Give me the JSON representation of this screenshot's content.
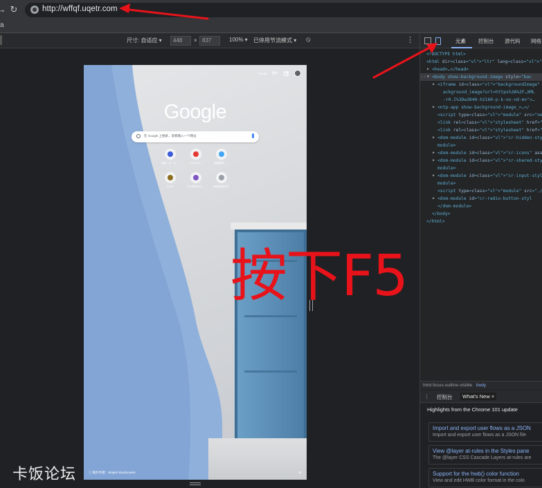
{
  "browser": {
    "url": "http://wffqf.uqetr.com",
    "bookmark_stub": "a"
  },
  "device_toolbar": {
    "dimensions_label": "尺寸: 自适应 ▾",
    "width": "448",
    "times": "×",
    "height": "837",
    "zoom": "100% ▾",
    "throttle": "已停用节流模式 ▾",
    "more": "⋮"
  },
  "ntp": {
    "gmail_link": "Gmail",
    "images_link": "图片",
    "logo": "Google",
    "search_placeholder": "在 Google 上搜索，或者输入一个网址",
    "shortcuts": [
      {
        "label": "网易 · 天 · 天…",
        "color": "#3b5bdb"
      },
      {
        "label": "YouTube",
        "color": "#e53935"
      },
      {
        "label": "百度翻译 · …",
        "color": "#42a5f5"
      },
      {
        "label": "Gmail",
        "color": "#8d6e1e"
      },
      {
        "label": "PDF转Word…",
        "color": "#7e57c2"
      },
      {
        "label": "添加快捷方式",
        "color": "#9aa0a6"
      }
    ],
    "credit": "照片作者：Wojtek Wyszkowski",
    "credit_prefix": "ⓘ",
    "pencil": "✎"
  },
  "annotation_text": "按下F5",
  "watermark": "卡饭论坛",
  "devtools": {
    "tabs": [
      "元素",
      "控制台",
      "源代码",
      "网络"
    ],
    "active_tab": "元素",
    "dom_lines": [
      {
        "text": "<!DOCTYPE html>",
        "indent": 0,
        "arrow": ""
      },
      {
        "text": "<html dir=\"ltr\" lang=\"zh\" class=\"focus-",
        "indent": 0,
        "arrow": ""
      },
      {
        "text": "<head>…</head>",
        "indent": 1,
        "arrow": "▶"
      },
      {
        "text": "<body show-background-image style=\"bac",
        "indent": 1,
        "arrow": "▼",
        "selected": true
      },
      {
        "text": "<iframe id=\"backgroundImage\" src=\"ch",
        "indent": 2,
        "arrow": "▶"
      },
      {
        "text": "ackground_image?url=https%3A%2F…XML",
        "indent": 3,
        "arrow": ""
      },
      {
        "text": "-r0.I%3Dw3840-h2160-p-k-no-nd-mv\">…",
        "indent": 3,
        "arrow": ""
      },
      {
        "text": "<ntp-app show-background-image_>…</",
        "indent": 2,
        "arrow": "▶"
      },
      {
        "text": "<script type=\"module\" src=\"new_tab_p",
        "indent": 2,
        "arrow": ""
      },
      {
        "text": "<link rel=\"stylesheet\" href=\"chrome:",
        "indent": 2,
        "arrow": ""
      },
      {
        "text": "<link rel=\"stylesheet\" href=\"shared_",
        "indent": 2,
        "arrow": ""
      },
      {
        "text": "<dom-module id=\"cr-hidden-style\" ass",
        "indent": 2,
        "arrow": "▶"
      },
      {
        "text": "module>",
        "indent": 2,
        "arrow": ""
      },
      {
        "text": "<dom-module id=\"cr-icons\" assetpath=",
        "indent": 2,
        "arrow": "▶"
      },
      {
        "text": "<dom-module id=\"cr-shared-style\" ass",
        "indent": 2,
        "arrow": "▶"
      },
      {
        "text": "module>",
        "indent": 2,
        "arrow": ""
      },
      {
        "text": "<dom-module id=\"cr-input-style\" asse",
        "indent": 2,
        "arrow": "▶"
      },
      {
        "text": "module>",
        "indent": 2,
        "arrow": ""
      },
      {
        "text": "<script type=\"module\" src=\"./lazy_lo",
        "indent": 2,
        "arrow": ""
      },
      {
        "text": "<dom-module id=\"cr-radio-button-styl",
        "indent": 2,
        "arrow": "▶"
      },
      {
        "text": "</dom-module>",
        "indent": 2,
        "arrow": ""
      },
      {
        "text": "</body>",
        "indent": 1,
        "arrow": ""
      },
      {
        "text": "</html>",
        "indent": 0,
        "arrow": ""
      }
    ],
    "breadcrumb": [
      "html.focus-outline-visible",
      "body"
    ],
    "drawer_tabs": [
      "控制台",
      "What's New"
    ],
    "drawer_close": "×",
    "drawer_more": "⋮",
    "highlights": "Highlights from the Chrome 101 update",
    "cards": [
      {
        "title": "Import and export user flows as a JSON",
        "desc": "Import and export user flows as a JSON file"
      },
      {
        "title": "View @layer at-rules in the Styles pane",
        "desc": "The @layer CSS Cascade Layers at-rules are"
      },
      {
        "title": "Support for the hwb() color function",
        "desc": "View and edit HWB color format in the colo"
      }
    ]
  },
  "colors": {
    "annotation": "#e8131a",
    "sky_blue_wall": "#8fb0db",
    "door_blue": "#5c8fb8"
  }
}
